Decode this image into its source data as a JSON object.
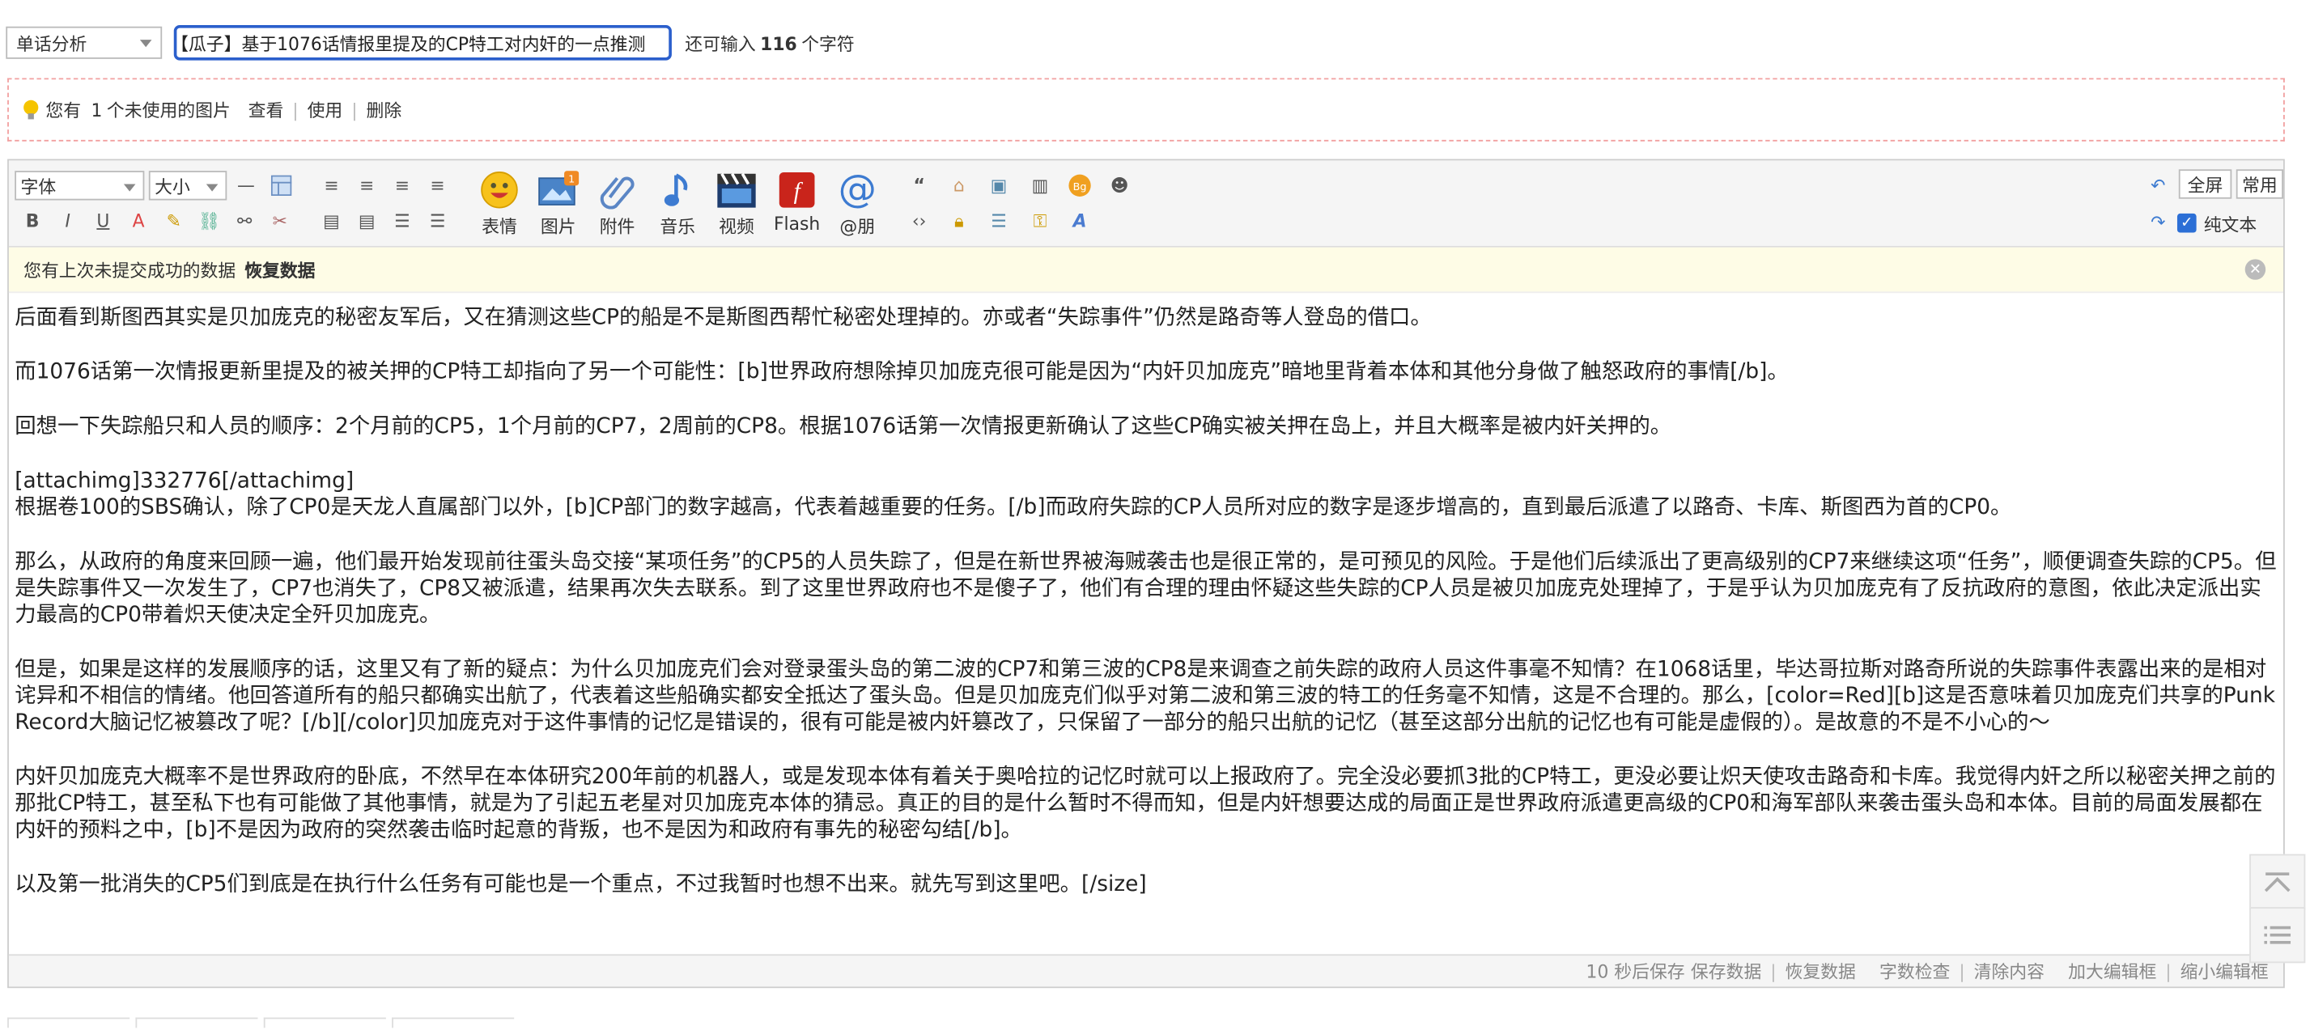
{
  "form": {
    "category_select": "单话分析",
    "title_value": "【瓜子】基于1076话情报里提及的CP特工对内奸的一点推测",
    "remain_prefix": "还可输入",
    "remain_count": "116",
    "remain_suffix": "个字符"
  },
  "notice": {
    "text_prefix": "您有",
    "count": "1",
    "text_suffix": "个未使用的图片",
    "view": "查看",
    "use": "使用",
    "delete": "删除"
  },
  "toolbar": {
    "font_select": "字体",
    "size_select": "大小",
    "big_buttons": [
      "表情",
      "图片",
      "附件",
      "音乐",
      "视频",
      "Flash",
      "@朋"
    ],
    "fullscreen": "全屏",
    "common": "常用",
    "plain_text": "纯文本",
    "plain_text_checked": true
  },
  "restore_bar": {
    "text": "您有上次未提交成功的数据",
    "action": "恢复数据"
  },
  "content": [
    "后面看到斯图西其实是贝加庞克的秘密友军后，又在猜测这些CP的船是不是斯图西帮忙秘密处理掉的。亦或者“失踪事件”仍然是路奇等人登岛的借口。",
    "而1076话第一次情报更新里提及的被关押的CP特工却指向了另一个可能性：[b]世界政府想除掉贝加庞克很可能是因为“内奸贝加庞克”暗地里背着本体和其他分身做了触怒政府的事情[/b]。",
    "回想一下失踪船只和人员的顺序：2个月前的CP5，1个月前的CP7，2周前的CP8。根据1076话第一次情报更新确认了这些CP确实被关押在岛上，并且大概率是被内奸关押的。",
    "[attachimg]332776[/attachimg]",
    "根据卷100的SBS确认，除了CP0是天龙人直属部门以外，[b]CP部门的数字越高，代表着越重要的任务。[/b]而政府失踪的CP人员所对应的数字是逐步增高的，直到最后派遣了以路奇、卡库、斯图西为首的CP0。",
    "那么，从政府的角度来回顾一遍，他们最开始发现前往蛋头岛交接“某项任务”的CP5的人员失踪了，但是在新世界被海贼袭击也是很正常的，是可预见的风险。于是他们后续派出了更高级别的CP7来继续这项“任务”，顺便调查失踪的CP5。但是失踪事件又一次发生了，CP7也消失了，CP8又被派遣，结果再次失去联系。到了这里世界政府也不是傻子了，他们有合理的理由怀疑这些失踪的CP人员是被贝加庞克处理掉了，于是乎认为贝加庞克有了反抗政府的意图，依此决定派出实力最高的CP0带着炽天使决定全歼贝加庞克。",
    "但是，如果是这样的发展顺序的话，这里又有了新的疑点：为什么贝加庞克们会对登录蛋头岛的第二波的CP7和第三波的CP8是来调查之前失踪的政府人员这件事毫不知情？在1068话里，毕达哥拉斯对路奇所说的失踪事件表露出来的是相对诧异和不相信的情绪。他回答道所有的船只都确实出航了，代表着这些船确实都安全抵达了蛋头岛。但是贝加庞克们似乎对第二波和第三波的特工的任务毫不知情，这是不合理的。那么，[color=Red][b]这是否意味着贝加庞克们共享的Punk Record大脑记忆被篡改了呢？[/b][/color]贝加庞克对于这件事情的记忆是错误的，很有可能是被内奸篡改了，只保留了一部分的船只出航的记忆（甚至这部分出航的记忆也有可能是虚假的）。是故意的不是不小心的～",
    "内奸贝加庞克大概率不是世界政府的卧底，不然早在本体研究200年前的机器人，或是发现本体有着关于奥哈拉的记忆时就可以上报政府了。完全没必要抓3批的CP特工，更没必要让炽天使攻击路奇和卡库。我觉得内奸之所以秘密关押之前的那批CP特工，甚至私下也有可能做了其他事情，就是为了引起五老星对贝加庞克本体的猜忌。真正的目的是什么暂时不得而知，但是内奸想要达成的局面正是世界政府派遣更高级的CP0和海军部队来袭击蛋头岛和本体。目前的局面发展都在内奸的预料之中，[b]不是因为政府的突然袭击临时起意的背叛，也不是因为和政府有事先的秘密勾结[/b]。",
    "以及第一批消失的CP5们到底是在执行什么任务有可能也是一个重点，不过我暂时也想不出来。就先写到这里吧。[/size]"
  ],
  "statusbar": {
    "autosave": "10 秒后保存",
    "save": "保存数据",
    "restore": "恢复数据",
    "wordcheck": "字数检查",
    "clear": "清除内容",
    "enlarge": "加大编辑框",
    "shrink": "缩小编辑框"
  }
}
